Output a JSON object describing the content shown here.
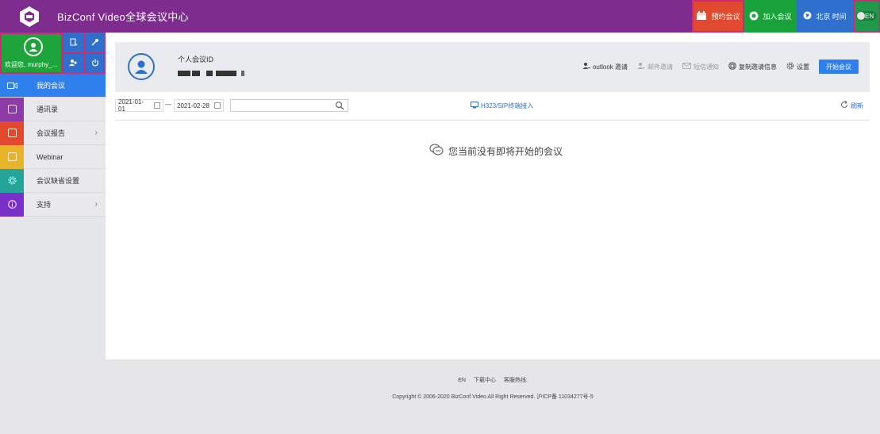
{
  "app": {
    "title": "BizConf Video全球会议中心"
  },
  "topbar": {
    "book_label": "预约会议",
    "join_label": "加入会议",
    "time_label": "北京 时间",
    "lang_label": "EN"
  },
  "sidebar": {
    "welcome": "欢迎您, murphy_...",
    "items": [
      {
        "label": "我的会议",
        "color": "#2f80ed",
        "active": true
      },
      {
        "label": "通讯录",
        "color": "#8e3aa8"
      },
      {
        "label": "会议报告",
        "color": "#e14a2f",
        "chevron": "›"
      },
      {
        "label": "Webinar",
        "color": "#e8b52a"
      },
      {
        "label": "会议缺省设置",
        "color": "#23a59a"
      },
      {
        "label": "支持",
        "color": "#7b2fc9",
        "chevron": "›"
      }
    ]
  },
  "card": {
    "pid_label": "个人会议ID",
    "pid_value": "",
    "actions": {
      "outlook": "outlook 邀请",
      "email": "邮件邀请",
      "sms": "短信通知",
      "copy": "复制邀请信息",
      "settings": "设置"
    },
    "start_label": "开始会议"
  },
  "filter": {
    "date_from": "2021-01-01",
    "date_sep": "—",
    "date_to": "2021-02-28",
    "search_value": "",
    "h323_label": "H323/SIP终端接入",
    "refresh_label": "刷新"
  },
  "empty_text": "您当前没有即将开始的会议",
  "footer": {
    "links": [
      "EN",
      "下载中心",
      "客服热线:"
    ],
    "copyright": "Copyright © 2006-2020 BizConf Video All Right Reserved. 沪ICP备 11034277号-5"
  },
  "colors": {
    "topbar": "#7e2c8e",
    "accent_blue": "#2f80ed",
    "green": "#1da43b",
    "red": "#e14a2f"
  }
}
